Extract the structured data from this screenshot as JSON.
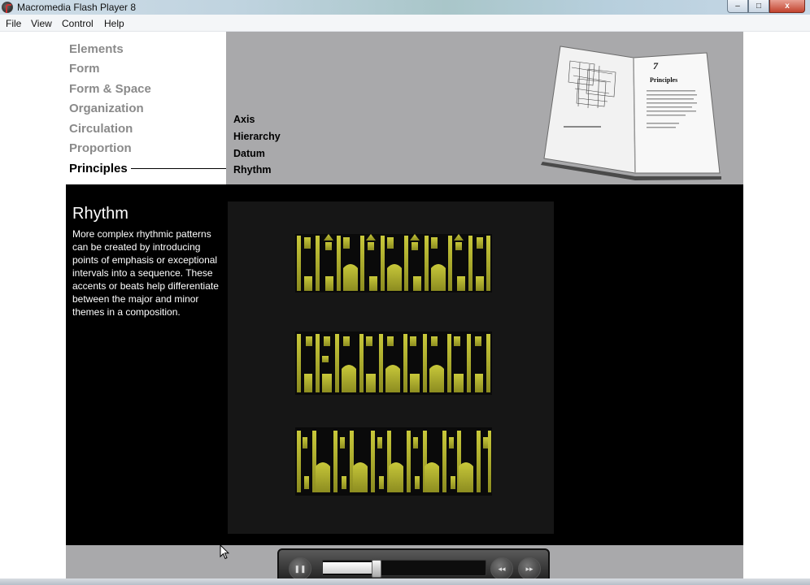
{
  "window": {
    "title": "Macromedia Flash Player 8",
    "controls": {
      "minimize": "–",
      "maximize": "□",
      "close": "x"
    }
  },
  "menu": [
    "File",
    "View",
    "Control",
    "Help"
  ],
  "nav": {
    "items": [
      "Elements",
      "Form",
      "Form & Space",
      "Organization",
      "Circulation",
      "Proportion",
      "Principles"
    ],
    "active_index": 6
  },
  "subnav": {
    "items": [
      "Axis",
      "Hierarchy",
      "Datum",
      "Rhythm"
    ]
  },
  "book": {
    "chapter_number": "7",
    "chapter_title": "Principles"
  },
  "content": {
    "title": "Rhythm",
    "body": "More complex rhythmic patterns can be created by introducing points of emphasis or exceptional intervals into a sequence. These accents or beats help differentiate between the major and minor themes in a composition."
  },
  "player": {
    "progress": 0.3,
    "pause_icon": "pause-icon",
    "rewind_icon": "rewind-icon",
    "forward_icon": "fast-forward-icon"
  },
  "colors": {
    "panel_gray": "#a9a9ab",
    "stage_black": "#000000",
    "accent_yellow": "#a8a82c",
    "nav_inactive": "#8a8a8a"
  }
}
